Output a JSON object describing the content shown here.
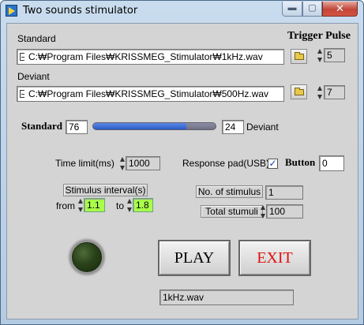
{
  "window": {
    "title": "Two sounds stimulator",
    "minimize_glyph": "▬",
    "maximize_glyph": "▢",
    "close_glyph": "✕"
  },
  "files": {
    "standard_label": "Standard",
    "standard_path": "C:₩Program Files₩KRISSMEG_Stimulator₩1kHz.wav",
    "deviant_label": "Deviant",
    "deviant_path": "C:₩Program Files₩KRISSMEG_Stimulator₩500Hz.wav",
    "trigger_pulse_label": "Trigger Pulse",
    "standard_trigger": "5",
    "deviant_trigger": "7"
  },
  "ratio": {
    "standard_label": "Standard",
    "standard_value": "76",
    "deviant_value": "24",
    "deviant_label": "Deviant",
    "slider_fraction": 0.76
  },
  "settings": {
    "time_limit_label": "Time limit(ms)",
    "time_limit_value": "1000",
    "response_pad_label": "Response pad(USB)",
    "response_pad_checked": "✓",
    "button_label": "Button",
    "button_value": "0",
    "stimulus_interval_label": "Stimulus interval(s)",
    "from_label": "from",
    "from_value": "1.1",
    "to_label": "to",
    "to_value": "1.8",
    "num_stimulus_label": "No. of stimulus",
    "num_stimulus_value": "1",
    "total_stimuli_label": "Total stumuli",
    "total_stimuli_value": "100"
  },
  "controls": {
    "play_label": "PLAY",
    "exit_label": "EXIT",
    "current_file": "1kHz.wav",
    "colors": {
      "exit_text": "#e01010",
      "led": "#2a4219",
      "numeric_highlight": "#a9ff4a"
    }
  }
}
